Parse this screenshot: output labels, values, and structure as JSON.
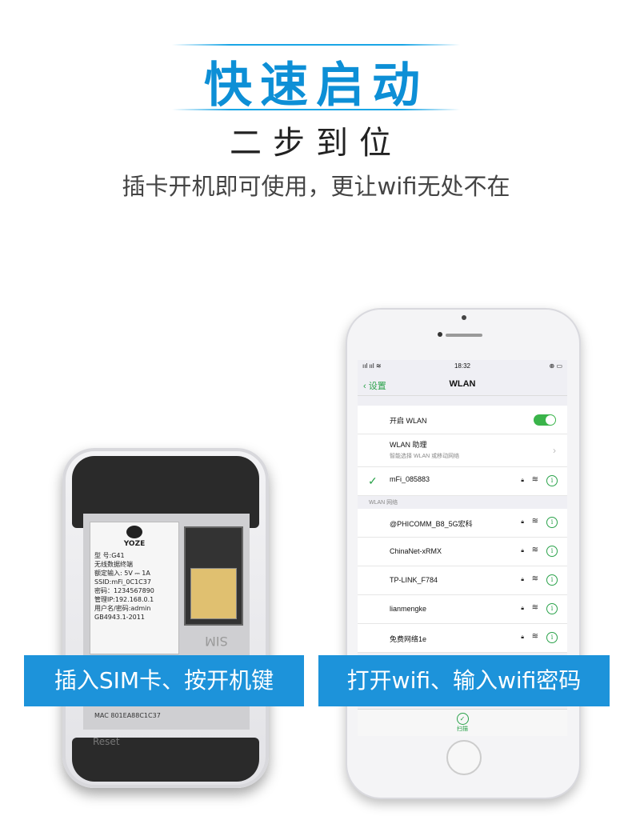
{
  "header": {
    "title": "快速启动",
    "subtitle": "二步到位",
    "tagline": "插卡开机即可使用，更让wifi无处不在"
  },
  "router": {
    "brand": "YOZE",
    "label_lines": [
      "型 号:G41",
      "无线数据终端",
      "额定输入: 5V ⎓ 1A",
      "SSID:mFi_0C1C37",
      "密码：1234567890",
      "管理IP:192.168.0.1",
      "用户名/密码:admin",
      "GB4943.1-2011"
    ],
    "mac": "MAC 801EA88C1C37",
    "reset": "Reset",
    "sim_text": "SIM"
  },
  "phone": {
    "status": {
      "left": "ııl ııl ≋",
      "time": "18:32",
      "right": "⊕ ▭"
    },
    "nav": {
      "back": "设置",
      "title": "WLAN"
    },
    "toggle_row": {
      "label": "开启 WLAN",
      "on": true
    },
    "assistant_row": {
      "label": "WLAN 助理",
      "sub": "智能选择 WLAN 或移动网络"
    },
    "connected": {
      "name": "mFi_085883"
    },
    "section_header": "WLAN 网络",
    "networks": [
      {
        "name": "@PHICOMM_B8_5G宏科"
      },
      {
        "name": "ChinaNet-xRMX"
      },
      {
        "name": "TP-LINK_F784"
      },
      {
        "name": "lianmengke"
      },
      {
        "name": "免费网络1e"
      }
    ],
    "scan_label": "扫描",
    "icons": {
      "lock": "lock-icon",
      "wifi": "wifi-icon",
      "info": "info-icon"
    }
  },
  "banners": {
    "left": "插入SIM卡、按开机键",
    "right": "打开wifi、输入wifi密码"
  },
  "colors": {
    "accent": "#1d93da",
    "title": "#0d8fd6",
    "green": "#2aa24a"
  }
}
